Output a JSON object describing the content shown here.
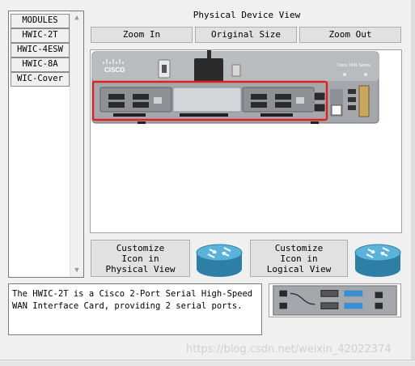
{
  "module_list": {
    "items": [
      {
        "label": "MODULES"
      },
      {
        "label": "HWIC-2T"
      },
      {
        "label": "HWIC-4ESW"
      },
      {
        "label": "HWIC-8A"
      },
      {
        "label": "WIC-Cover"
      }
    ]
  },
  "physical_view": {
    "title": "Physical Device View",
    "zoom_in": "Zoom In",
    "original_size": "Original Size",
    "zoom_out": "Zoom Out",
    "device_brand": "CISCO",
    "device_model": "Cisco 1941 Series"
  },
  "customize": {
    "physical_lines": [
      "Customize",
      "Icon in",
      "Physical View"
    ],
    "logical_lines": [
      "Customize",
      "Icon in",
      "Logical View"
    ]
  },
  "description": "The HWIC-2T is a Cisco 2-Port Serial High-Speed\nWAN Interface Card, providing 2 serial ports.",
  "watermark": "https://blog.csdn.net/weixin_42022374",
  "colors": {
    "highlight": "#e0201c",
    "router_blue": "#3b9ec9",
    "chassis": "#9ea2a6"
  }
}
